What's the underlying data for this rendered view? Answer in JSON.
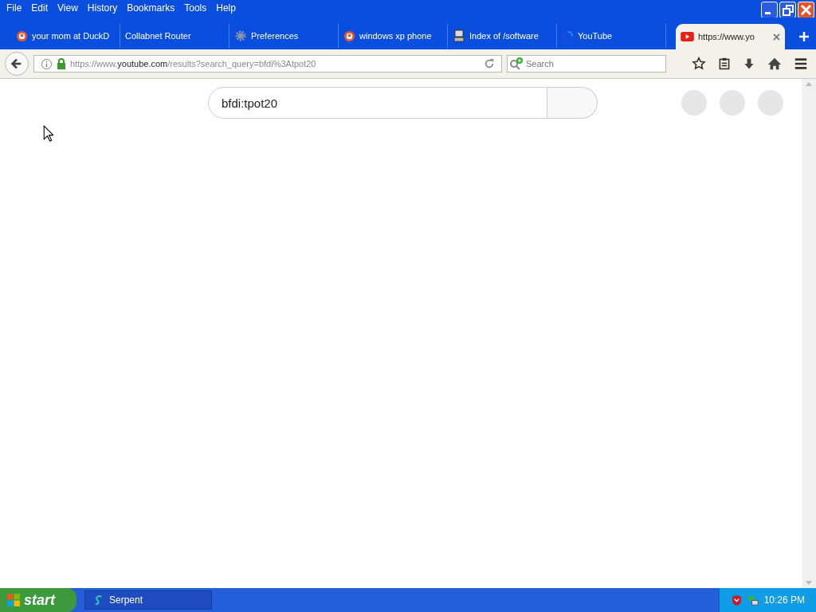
{
  "menu_bar": [
    "File",
    "Edit",
    "View",
    "History",
    "Bookmarks",
    "Tools",
    "Help"
  ],
  "tabs": [
    {
      "label": "your mom at DuckD",
      "kind": "duck",
      "selected": false
    },
    {
      "label": "Collabnet Router",
      "kind": "none",
      "selected": false
    },
    {
      "label": "Preferences",
      "kind": "gear",
      "selected": false
    },
    {
      "label": "windows xp phone",
      "kind": "duck",
      "selected": false
    },
    {
      "label": "Index of /software",
      "kind": "server",
      "selected": false
    },
    {
      "label": "YouTube",
      "kind": "loading",
      "selected": false
    },
    {
      "label": "https://www.yo",
      "kind": "youtube",
      "selected": true
    }
  ],
  "address_bar": {
    "prefix": "https://www.",
    "domain": "youtube.com",
    "suffix": "/results?search_query=bfdi%3Atpot20"
  },
  "browser_search": {
    "placeholder": "Search"
  },
  "page": {
    "search_field": {
      "value": "bfdi:tpot20"
    }
  },
  "taskbar": {
    "start": "start",
    "tasks": [
      {
        "label": "Serpent"
      }
    ],
    "clock": "10:26 PM"
  }
}
